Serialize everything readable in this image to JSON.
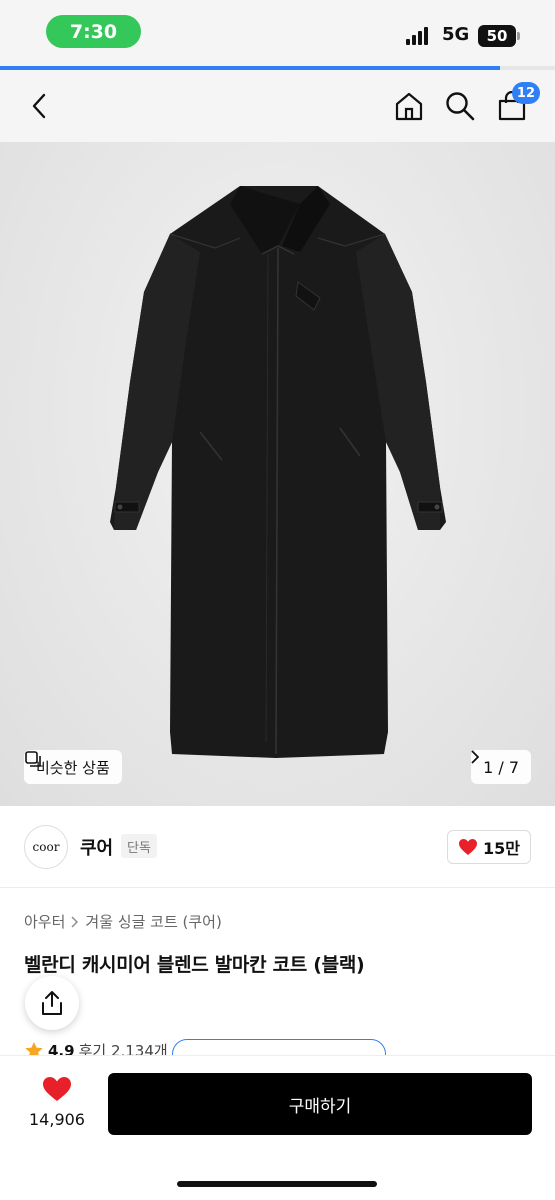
{
  "status_bar": {
    "time": "7:30",
    "network": "5G",
    "battery": "50"
  },
  "page_progress": 0.9,
  "nav": {
    "cart_count": "12"
  },
  "gallery": {
    "similar_label": "비슷한 상품",
    "page_indicator": "1 / 7"
  },
  "brand": {
    "logo_text": "coor",
    "name": "쿠어",
    "tag": "단독",
    "likes": "15만"
  },
  "breadcrumb": [
    "아우터",
    "겨울 싱글 코트 (쿠어)"
  ],
  "product": {
    "title": "벨란디 캐시미어 블렌드 발마칸 코트 (블랙)",
    "rating": "4.9",
    "reviews": "후기 2,134개"
  },
  "bottom": {
    "wish_count": "14,906",
    "buy_label": "구매하기"
  },
  "colors": {
    "accent": "#2f7ff5",
    "heart": "#e8202a",
    "time_pill": "#34c759"
  }
}
